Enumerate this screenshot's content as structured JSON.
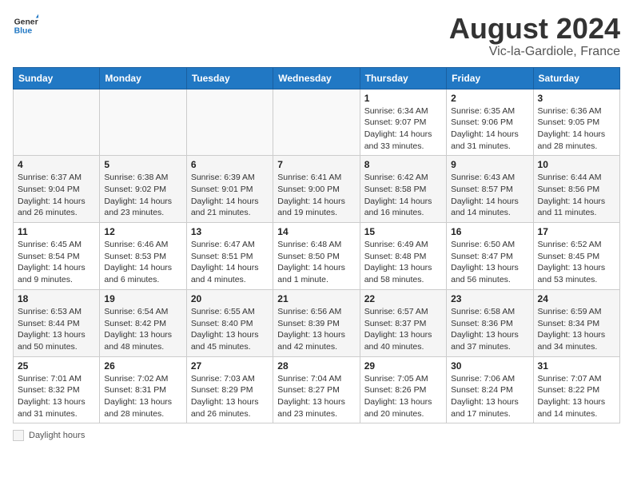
{
  "header": {
    "logo_general": "General",
    "logo_blue": "Blue",
    "title": "August 2024",
    "subtitle": "Vic-la-Gardiole, France"
  },
  "days_of_week": [
    "Sunday",
    "Monday",
    "Tuesday",
    "Wednesday",
    "Thursday",
    "Friday",
    "Saturday"
  ],
  "weeks": [
    [
      {
        "day": "",
        "info": ""
      },
      {
        "day": "",
        "info": ""
      },
      {
        "day": "",
        "info": ""
      },
      {
        "day": "",
        "info": ""
      },
      {
        "day": "1",
        "info": "Sunrise: 6:34 AM\nSunset: 9:07 PM\nDaylight: 14 hours and 33 minutes."
      },
      {
        "day": "2",
        "info": "Sunrise: 6:35 AM\nSunset: 9:06 PM\nDaylight: 14 hours and 31 minutes."
      },
      {
        "day": "3",
        "info": "Sunrise: 6:36 AM\nSunset: 9:05 PM\nDaylight: 14 hours and 28 minutes."
      }
    ],
    [
      {
        "day": "4",
        "info": "Sunrise: 6:37 AM\nSunset: 9:04 PM\nDaylight: 14 hours and 26 minutes."
      },
      {
        "day": "5",
        "info": "Sunrise: 6:38 AM\nSunset: 9:02 PM\nDaylight: 14 hours and 23 minutes."
      },
      {
        "day": "6",
        "info": "Sunrise: 6:39 AM\nSunset: 9:01 PM\nDaylight: 14 hours and 21 minutes."
      },
      {
        "day": "7",
        "info": "Sunrise: 6:41 AM\nSunset: 9:00 PM\nDaylight: 14 hours and 19 minutes."
      },
      {
        "day": "8",
        "info": "Sunrise: 6:42 AM\nSunset: 8:58 PM\nDaylight: 14 hours and 16 minutes."
      },
      {
        "day": "9",
        "info": "Sunrise: 6:43 AM\nSunset: 8:57 PM\nDaylight: 14 hours and 14 minutes."
      },
      {
        "day": "10",
        "info": "Sunrise: 6:44 AM\nSunset: 8:56 PM\nDaylight: 14 hours and 11 minutes."
      }
    ],
    [
      {
        "day": "11",
        "info": "Sunrise: 6:45 AM\nSunset: 8:54 PM\nDaylight: 14 hours and 9 minutes."
      },
      {
        "day": "12",
        "info": "Sunrise: 6:46 AM\nSunset: 8:53 PM\nDaylight: 14 hours and 6 minutes."
      },
      {
        "day": "13",
        "info": "Sunrise: 6:47 AM\nSunset: 8:51 PM\nDaylight: 14 hours and 4 minutes."
      },
      {
        "day": "14",
        "info": "Sunrise: 6:48 AM\nSunset: 8:50 PM\nDaylight: 14 hours and 1 minute."
      },
      {
        "day": "15",
        "info": "Sunrise: 6:49 AM\nSunset: 8:48 PM\nDaylight: 13 hours and 58 minutes."
      },
      {
        "day": "16",
        "info": "Sunrise: 6:50 AM\nSunset: 8:47 PM\nDaylight: 13 hours and 56 minutes."
      },
      {
        "day": "17",
        "info": "Sunrise: 6:52 AM\nSunset: 8:45 PM\nDaylight: 13 hours and 53 minutes."
      }
    ],
    [
      {
        "day": "18",
        "info": "Sunrise: 6:53 AM\nSunset: 8:44 PM\nDaylight: 13 hours and 50 minutes."
      },
      {
        "day": "19",
        "info": "Sunrise: 6:54 AM\nSunset: 8:42 PM\nDaylight: 13 hours and 48 minutes."
      },
      {
        "day": "20",
        "info": "Sunrise: 6:55 AM\nSunset: 8:40 PM\nDaylight: 13 hours and 45 minutes."
      },
      {
        "day": "21",
        "info": "Sunrise: 6:56 AM\nSunset: 8:39 PM\nDaylight: 13 hours and 42 minutes."
      },
      {
        "day": "22",
        "info": "Sunrise: 6:57 AM\nSunset: 8:37 PM\nDaylight: 13 hours and 40 minutes."
      },
      {
        "day": "23",
        "info": "Sunrise: 6:58 AM\nSunset: 8:36 PM\nDaylight: 13 hours and 37 minutes."
      },
      {
        "day": "24",
        "info": "Sunrise: 6:59 AM\nSunset: 8:34 PM\nDaylight: 13 hours and 34 minutes."
      }
    ],
    [
      {
        "day": "25",
        "info": "Sunrise: 7:01 AM\nSunset: 8:32 PM\nDaylight: 13 hours and 31 minutes."
      },
      {
        "day": "26",
        "info": "Sunrise: 7:02 AM\nSunset: 8:31 PM\nDaylight: 13 hours and 28 minutes."
      },
      {
        "day": "27",
        "info": "Sunrise: 7:03 AM\nSunset: 8:29 PM\nDaylight: 13 hours and 26 minutes."
      },
      {
        "day": "28",
        "info": "Sunrise: 7:04 AM\nSunset: 8:27 PM\nDaylight: 13 hours and 23 minutes."
      },
      {
        "day": "29",
        "info": "Sunrise: 7:05 AM\nSunset: 8:26 PM\nDaylight: 13 hours and 20 minutes."
      },
      {
        "day": "30",
        "info": "Sunrise: 7:06 AM\nSunset: 8:24 PM\nDaylight: 13 hours and 17 minutes."
      },
      {
        "day": "31",
        "info": "Sunrise: 7:07 AM\nSunset: 8:22 PM\nDaylight: 13 hours and 14 minutes."
      }
    ]
  ],
  "legend": {
    "label": "Daylight hours"
  }
}
